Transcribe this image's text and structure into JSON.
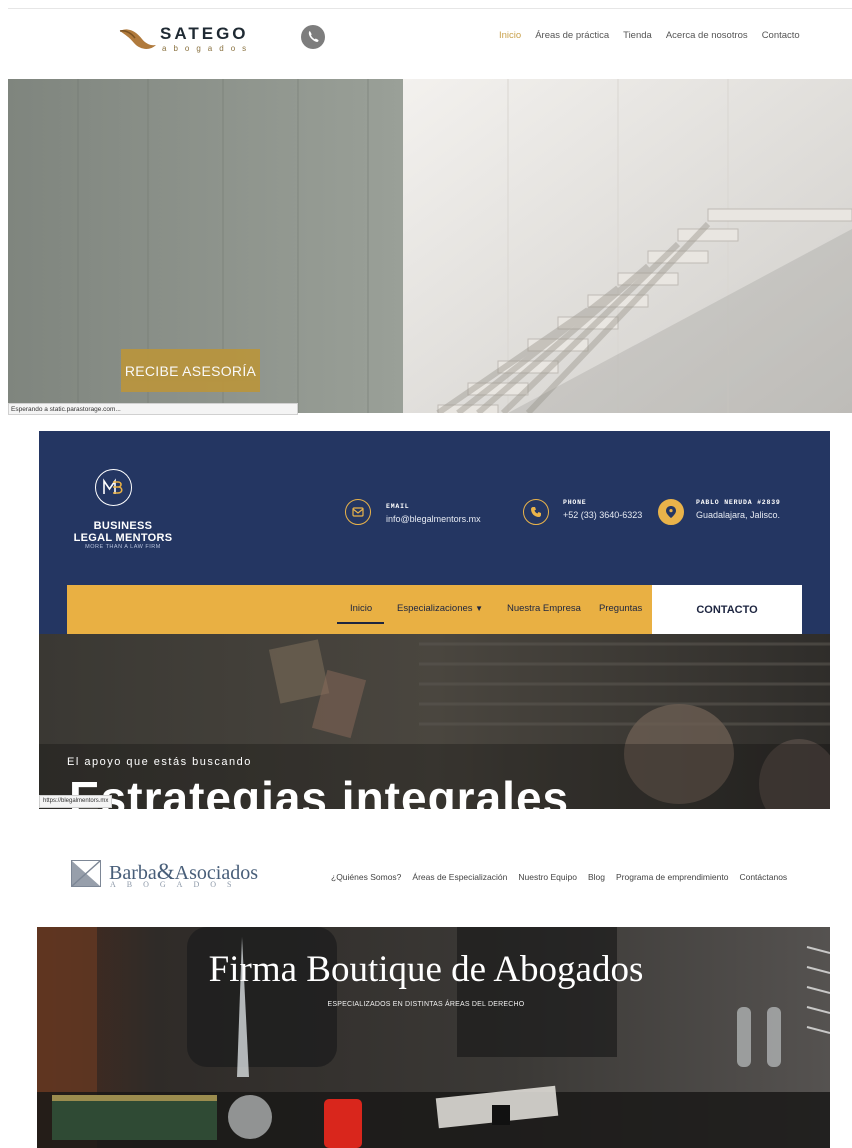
{
  "satego": {
    "brand": "SATEGO",
    "brand_sub": "abogados",
    "nav": [
      "Inicio",
      "Áreas de práctica",
      "Tienda",
      "Acerca de nosotros",
      "Contacto"
    ],
    "cta": "RECIBE ASESORÍA",
    "status_text": "Esperando a static.parastorage.com...",
    "accent_color": "#c9a24d",
    "icons": [
      "whatsapp-icon"
    ]
  },
  "blm": {
    "brand_line1": "BUSINESS",
    "brand_line2": "LEGAL MENTORS",
    "tagline": "MORE THAN A LAW FIRM",
    "email_label": "EMAIL",
    "email": "info@blegalmentors.mx",
    "phone_label": "PHONE",
    "phone": "+52 (33) 3640-6323",
    "address_label": "PABLO NERUDA #2839",
    "address": "Guadalajara, Jalisco.",
    "nav": [
      "Inicio",
      "Especializaciones",
      "Nuestra Empresa",
      "Preguntas"
    ],
    "contact_button": "CONTACTO",
    "hero_tagline": "El apoyo que estás buscando",
    "hero_headline": "Estrategias integrales",
    "status_text": "https://blegalmentors.mx",
    "bg_color": "#243662",
    "accent_color": "#e9b043"
  },
  "barba": {
    "brand_left": "Barba",
    "brand_amp": "&",
    "brand_right": "Asociados",
    "brand_sub": "ABOGADOS",
    "nav": [
      "¿Quiénes Somos?",
      "Áreas de Especialización",
      "Nuestro Equipo",
      "Blog",
      "Programa de emprendimiento",
      "Contáctanos"
    ],
    "hero_title": "Firma Boutique de Abogados",
    "hero_subtitle": "ESPECIALIZADOS EN DISTINTAS ÁREAS DEL DERECHO",
    "brand_color": "#485e79"
  }
}
